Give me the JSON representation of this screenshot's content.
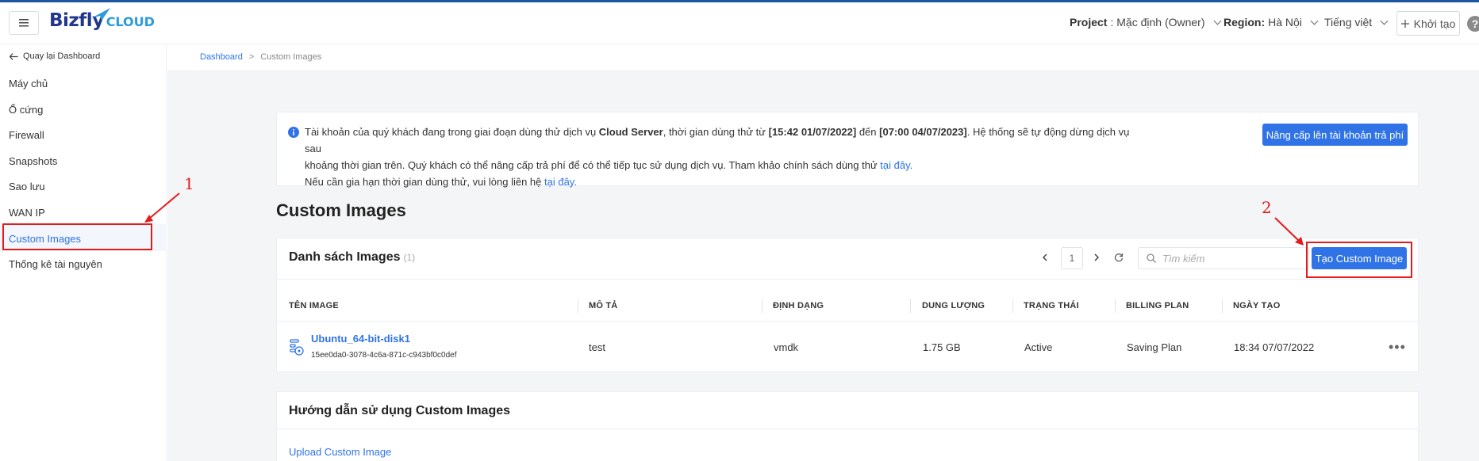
{
  "header": {
    "logo_main": "Bizfly",
    "logo_sub": "CLOUD",
    "project_label": "Project",
    "project_value": ": Mặc định (Owner)",
    "region_label": "Region:",
    "region_value": "Hà Nội",
    "language": "Tiếng việt",
    "create_label": "Khởi tạo",
    "help_icon": "?"
  },
  "sidebar": {
    "back_label": "Quay lại Dashboard",
    "items": [
      {
        "label": "Máy chủ"
      },
      {
        "label": "Ổ cứng"
      },
      {
        "label": "Firewall"
      },
      {
        "label": "Snapshots"
      },
      {
        "label": "Sao lưu"
      },
      {
        "label": "WAN IP"
      },
      {
        "label": "Custom Images",
        "active": true
      },
      {
        "label": "Thống kê tài nguyên"
      }
    ]
  },
  "breadcrumb": {
    "home": "Dashboard",
    "separator": ">",
    "current": "Custom Images"
  },
  "notice": {
    "p1_a": "Tài khoản của quý khách đang trong giai đoạn dùng thử dịch vụ ",
    "p1_b": "Cloud Server",
    "p1_c": ", thời gian dùng thử từ ",
    "p1_d": "[15:42 01/07/2022]",
    "p1_e": " đến ",
    "p1_f": "[07:00 04/07/2023]",
    "p1_g": ". Hệ thống sẽ tự động dừng dịch vụ sau",
    "p2_a": "khoảng thời gian trên. Quý khách có thể nâng cấp trả phí để có thể tiếp tục sử dụng dịch vụ. Tham khảo chính sách dùng thử ",
    "p2_link": "tại đây.",
    "p3_a": "Nếu cần gia hạn thời gian dùng thử, vui lòng liên hệ ",
    "p3_link": "tại đây.",
    "upgrade_button": "Nâng cấp lên tài khoản trả phí"
  },
  "page_title": "Custom Images",
  "list": {
    "title": "Danh sách Images",
    "count": "(1)",
    "page": "1",
    "search_placeholder": "Tìm kiếm",
    "create_button": "Tạo Custom Image",
    "columns": [
      "TÊN IMAGE",
      "MÔ TẢ",
      "ĐỊNH DẠNG",
      "DUNG LƯỢNG",
      "TRẠNG THÁI",
      "BILLING PLAN",
      "NGÀY TẠO"
    ],
    "rows": [
      {
        "name": "Ubuntu_64-bit-disk1",
        "id": "15ee0da0-3078-4c6a-871c-c943bf0c0def",
        "description": "test",
        "format": "vmdk",
        "size": "1.75 GB",
        "status": "Active",
        "billing_plan": "Saving Plan",
        "created": "18:34 07/07/2022",
        "more": "•••"
      }
    ]
  },
  "guide": {
    "title": "Hướng dẫn sử dụng Custom Images",
    "upload_link": "Upload Custom Image"
  },
  "annotations": {
    "num1": "1",
    "num2": "2",
    "color": "#e31b1b"
  },
  "colors": {
    "primary": "#2f73e7",
    "brand_dark": "#22368c",
    "brand_light": "#2a9bdc"
  }
}
